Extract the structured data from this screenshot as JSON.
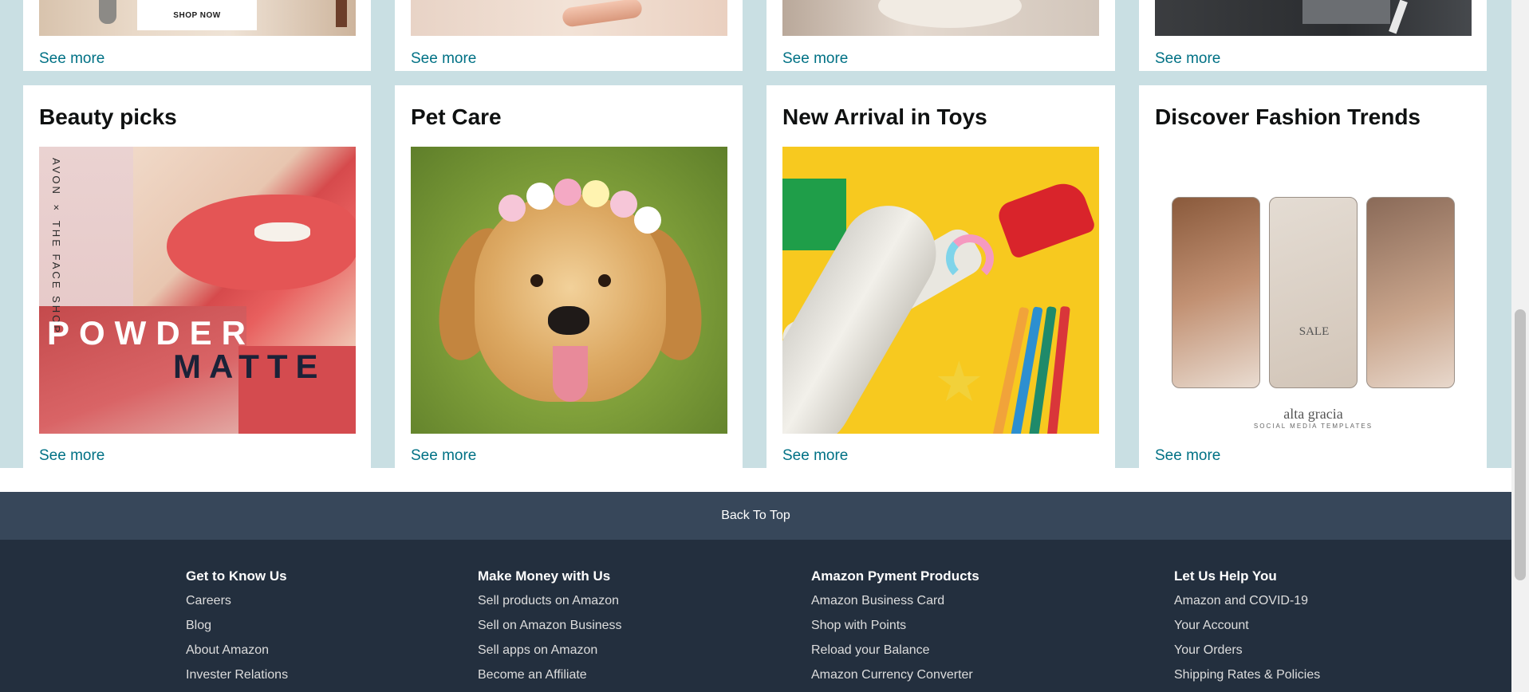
{
  "top_row": {
    "cards": [
      {
        "see_more": "See more",
        "shop_now": "SHOP NOW"
      },
      {
        "see_more": "See more"
      },
      {
        "see_more": "See more"
      },
      {
        "see_more": "See more"
      }
    ]
  },
  "bottom_row": {
    "cards": [
      {
        "title": "Beauty picks",
        "see_more": "See more",
        "image_text": {
          "brand": "AVON × THE FACE SHOP",
          "line1": "POWDER",
          "line2": "MATTE"
        }
      },
      {
        "title": "Pet Care",
        "see_more": "See more"
      },
      {
        "title": "New Arrival in Toys",
        "see_more": "See more"
      },
      {
        "title": "Discover Fashion Trends",
        "see_more": "See more",
        "image_text": {
          "sale": "SALE",
          "brand": "alta gracia",
          "brand_sub": "SOCIAL MEDIA TEMPLATES"
        }
      }
    ]
  },
  "back_to_top": "Back To Top",
  "footer": {
    "columns": [
      {
        "heading": "Get to Know Us",
        "links": [
          "Careers",
          "Blog",
          "About Amazon",
          "Invester Relations"
        ]
      },
      {
        "heading": "Make Money with Us",
        "links": [
          "Sell products on Amazon",
          "Sell on Amazon Business",
          "Sell apps on Amazon",
          "Become an Affiliate"
        ]
      },
      {
        "heading": "Amazon Pyment Products",
        "links": [
          "Amazon Business Card",
          "Shop with Points",
          "Reload your Balance",
          "Amazon Currency Converter"
        ]
      },
      {
        "heading": "Let Us Help You",
        "links": [
          "Amazon and COVID-19",
          "Your Account",
          "Your Orders",
          "Shipping Rates & Policies"
        ]
      }
    ]
  },
  "colors": {
    "page_bg": "#c9dfe3",
    "link": "#007185",
    "back_to_top_bg": "#37475a",
    "footer_bg": "#232f3e"
  }
}
